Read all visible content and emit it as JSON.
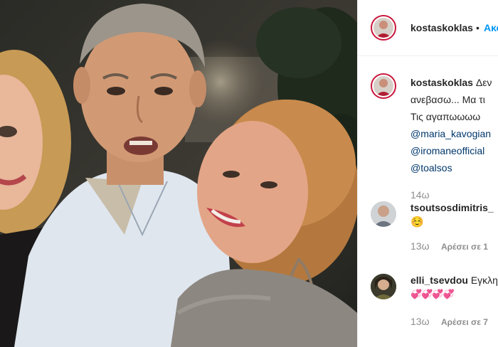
{
  "post": {
    "author": "kostaskoklas",
    "follow_label": "Ακο",
    "caption_lines": [
      "Δεν",
      "ανεβασω... Μα τι",
      "Τις αγαπωωωω"
    ],
    "mentions": [
      "@maria_kavogian",
      "@iromaneofficial",
      "@toalsos"
    ],
    "time": "14ω"
  },
  "comments": [
    {
      "author": "tsoutsosdimitris_",
      "text": "☺️",
      "time": "13ω",
      "likes_label": "Αρέσει σε 1"
    },
    {
      "author": "elli_tsevdou",
      "text_inline": "Εγκλη",
      "text": "💞💞💞💞",
      "time": "13ω",
      "likes_label": "Αρέσει σε 7"
    }
  ],
  "colors": {
    "follow_blue": "#0095f6",
    "mention_blue": "#00376b",
    "story_ring": "#c9163b",
    "muted_gray": "#8e8e8e"
  },
  "icons": {
    "comment_avatar_1": "person-avatar",
    "comment_avatar_2": "person-avatar"
  }
}
